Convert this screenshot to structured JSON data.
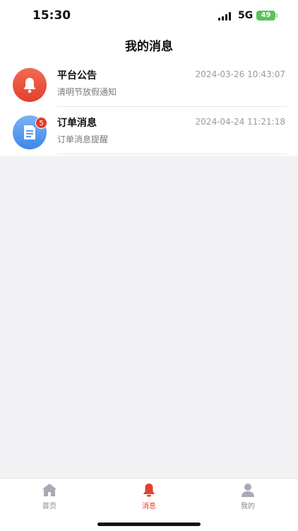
{
  "status_bar": {
    "time": "15:30",
    "network": "5G",
    "battery": "49"
  },
  "header": {
    "title": "我的消息"
  },
  "messages": [
    {
      "name": "平台公告",
      "preview": "清明节放假通知",
      "date": "2024-03-26 10:43:07",
      "icon": "bell-icon",
      "color": "#e84a36"
    },
    {
      "name": "订单消息",
      "preview": "订单消息提醒",
      "date": "2024-04-24 11:21:18",
      "icon": "document-icon",
      "color": "#4a8ff0",
      "badge": "5"
    }
  ],
  "tabbar": {
    "items": [
      {
        "label": "首页",
        "icon": "home-icon"
      },
      {
        "label": "消息",
        "icon": "bell-icon",
        "active": true
      },
      {
        "label": "我的",
        "icon": "user-icon"
      }
    ],
    "active_color": "#e2402e"
  }
}
